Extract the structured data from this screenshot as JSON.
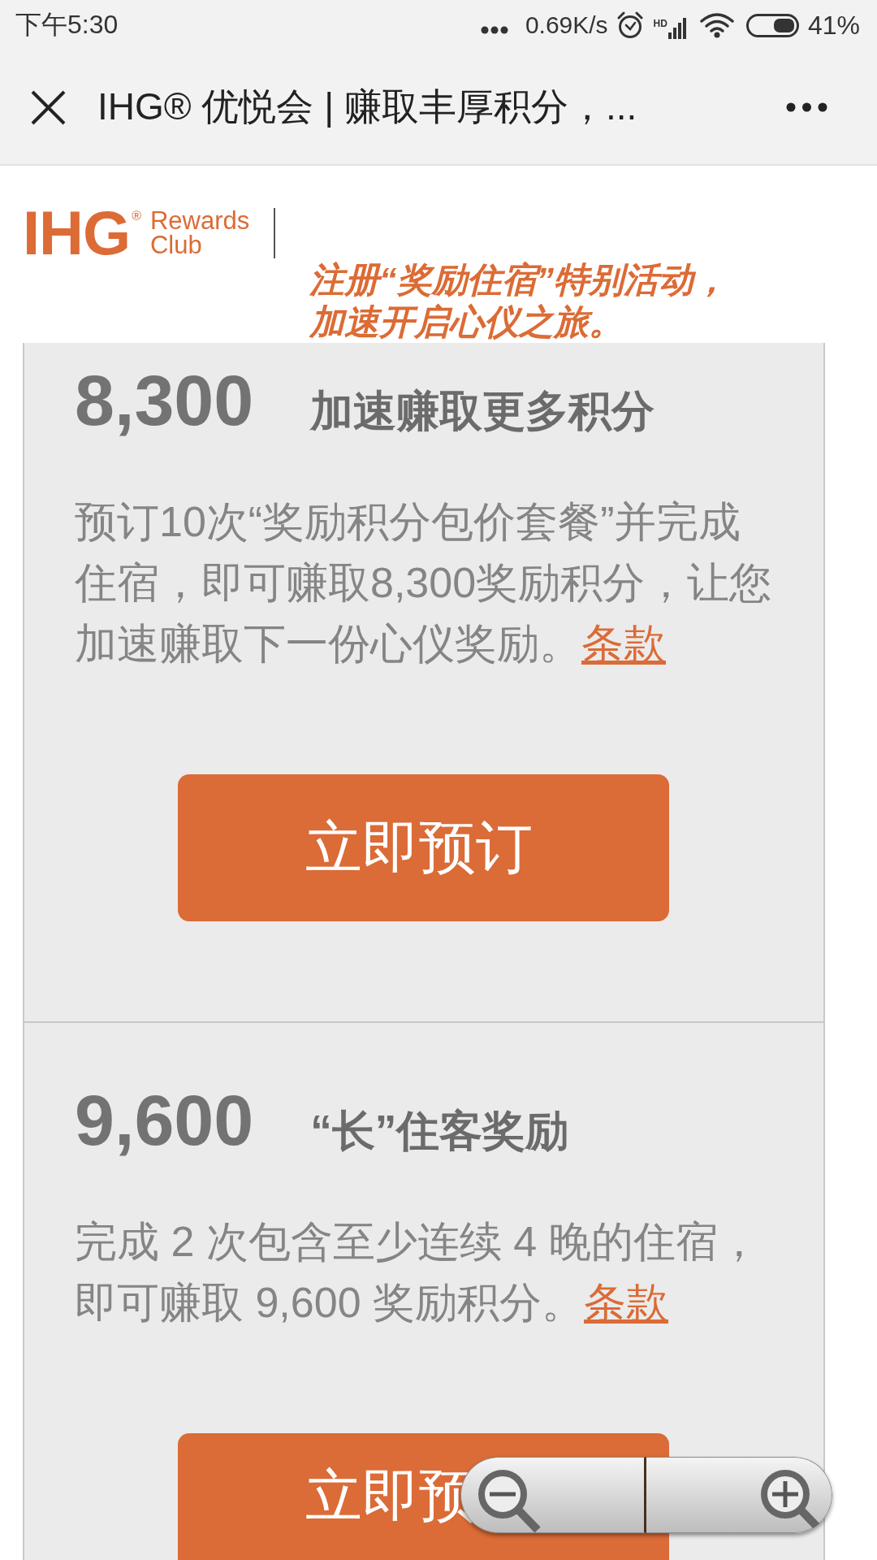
{
  "status_bar": {
    "time": "下午5:30",
    "net_speed": "0.69K/s",
    "signal_label": "HD",
    "battery": "41%"
  },
  "title_bar": {
    "title": "IHG® 优悦会 | 赚取丰厚积分，..."
  },
  "header": {
    "logo": {
      "mark": "IHG",
      "registered": "®",
      "name_lines": [
        "Rewards",
        "Club"
      ]
    },
    "tagline": "注册“奖励住宿”特别活动，加速开启心仪之旅。"
  },
  "offers": [
    {
      "points": "8,300",
      "title": "加速赚取更多积分",
      "description": "预订10次“奖励积分包价套餐”并完成住宿，即可赚取8,300奖励积分，让您加速赚取下一份心仪奖励。",
      "terms_link": "条款",
      "button": "立即预订"
    },
    {
      "points": "9,600",
      "title": "“长”住客奖励",
      "description": "完成 2 次包含至少连续 4 晚的住宿，即可赚取 9,600 奖励积分。",
      "terms_link": "条款",
      "button": "立即预"
    }
  ]
}
